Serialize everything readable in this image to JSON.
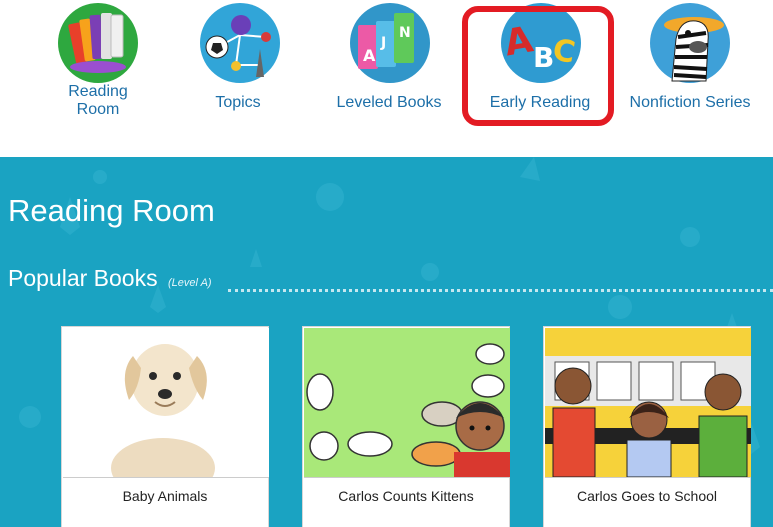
{
  "nav": {
    "items": [
      {
        "label_line1": "Reading",
        "label_line2": "Room",
        "icon": "books-icon"
      },
      {
        "label": "Topics",
        "icon": "topics-icon"
      },
      {
        "label": "Leveled Books",
        "icon": "alphabet-blocks-icon"
      },
      {
        "label": "Early Reading",
        "icon": "abc-letters-icon"
      },
      {
        "label": "Nonfiction Series",
        "icon": "zebra-icon"
      }
    ]
  },
  "page": {
    "title": "Reading Room",
    "section_title": "Popular Books",
    "section_level": "(Level A)"
  },
  "books": [
    {
      "title": "Baby Animals"
    },
    {
      "title": "Carlos Counts Kittens"
    },
    {
      "title": "Carlos Goes to School"
    }
  ],
  "colors": {
    "hero_bg": "#1aa3c2",
    "nav_text": "#1d6fa8",
    "highlight": "#e31b23"
  }
}
